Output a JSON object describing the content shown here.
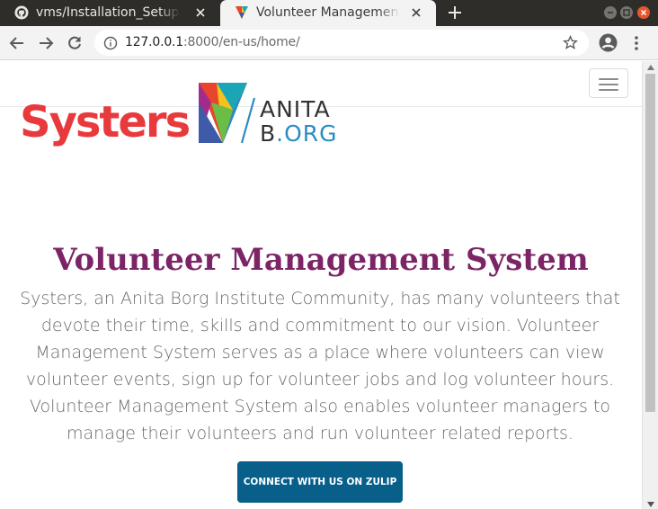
{
  "browser": {
    "tabs": [
      {
        "title": "vms/Installation_Setup.m",
        "icon": "github-icon",
        "active": false
      },
      {
        "title": "Volunteer Management S",
        "icon": "anitab-favicon",
        "active": true
      }
    ],
    "url_host": "127.0.0.1",
    "url_rest": ":8000/en-us/home/"
  },
  "site": {
    "logo_systers": "Systers",
    "logo_anita_line1": "ANITA",
    "logo_anita_line2_b": "B",
    "logo_anita_line2_org": ".ORG",
    "hero_title": "Volunteer Management System",
    "hero_body": "Systers, an Anita Borg Institute Community, has many volunteers that devote their time, skills and commitment to our vision. Volunteer Management System serves as a place where volunteers can view volunteer events, sign up for volunteer jobs and log volunteer hours. Volunteer Management System also enables volunteer managers to manage their volunteers and run volunteer related reports.",
    "cta_label": "CONNECT WITH US ON ZULIP"
  },
  "colors": {
    "systers_red": "#e83a3d",
    "title_purple": "#7b2466",
    "cta_blue": "#085f8a",
    "org_blue": "#2a8cc4"
  }
}
